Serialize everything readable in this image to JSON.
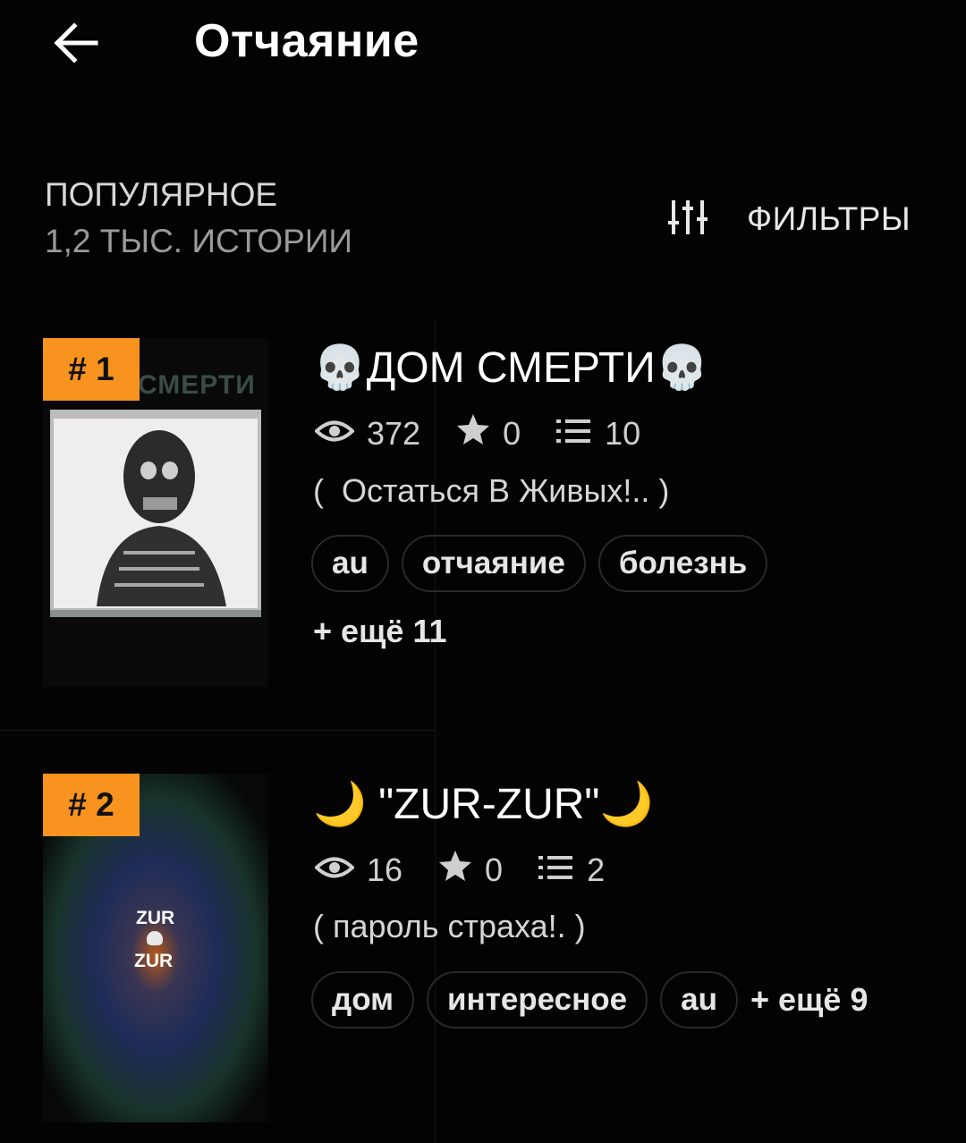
{
  "header": {
    "title": "Отчаяние"
  },
  "section": {
    "label": "ПОПУЛЯРНОЕ",
    "count": "1,2 ТЫС. ИСТОРИИ",
    "filters_label": "ФИЛЬТРЫ"
  },
  "stories": [
    {
      "rank": "# 1",
      "title": "💀ДОМ СМЕРТИ💀",
      "cover_text": "СМЕРТИ",
      "views": "372",
      "votes": "0",
      "parts": "10",
      "description": "(  Остаться В Живых!.. )",
      "tags": [
        "au",
        "отчаяние",
        "болезнь"
      ],
      "more": "+ ещё 11"
    },
    {
      "rank": "# 2",
      "title": "🌙 \"ZUR-ZUR\"🌙",
      "cover_text_top": "ZUR",
      "cover_text_bottom": "ZUR",
      "views": "16",
      "votes": "0",
      "parts": "2",
      "description": "( пароль страха!. )",
      "tags": [
        "дом",
        "интересное",
        "au"
      ],
      "more": "+ ещё 9"
    }
  ]
}
